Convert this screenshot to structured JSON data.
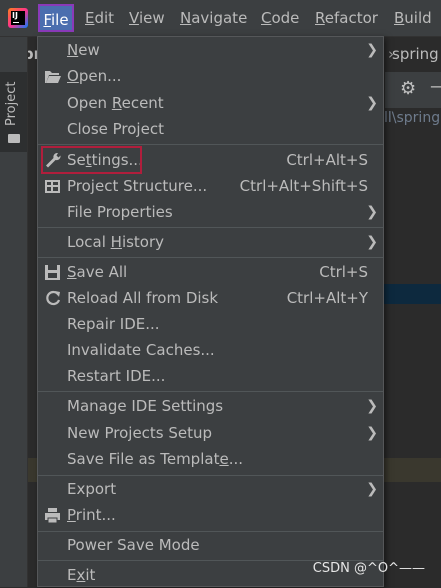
{
  "menubar": {
    "items": [
      {
        "pre": "",
        "u": "F",
        "post": "ile"
      },
      {
        "pre": "",
        "u": "E",
        "post": "dit"
      },
      {
        "pre": "",
        "u": "V",
        "post": "iew"
      },
      {
        "pre": "",
        "u": "N",
        "post": "avigate"
      },
      {
        "pre": "",
        "u": "C",
        "post": "ode"
      },
      {
        "pre": "",
        "u": "R",
        "post": "efactor"
      },
      {
        "pre": "",
        "u": "B",
        "post": "uild"
      }
    ]
  },
  "background": {
    "tab_text": "spr",
    "right_text": "spring",
    "path_text": "ll\\spring",
    "side_tab": "Project"
  },
  "file_menu": {
    "new": {
      "pre": "",
      "u": "N",
      "post": "ew"
    },
    "open": {
      "pre": "",
      "u": "O",
      "post": "pen..."
    },
    "open_recent": {
      "pre": "Open ",
      "u": "R",
      "post": "ecent"
    },
    "close_project": {
      "label": "Close Project"
    },
    "settings": {
      "pre": "Se",
      "u": "t",
      "post": "tings...",
      "shortcut": "Ctrl+Alt+S"
    },
    "project_structure": {
      "label": "Project Structure...",
      "shortcut": "Ctrl+Alt+Shift+S"
    },
    "file_properties": {
      "label": "File Properties"
    },
    "local_history": {
      "pre": "Local ",
      "u": "H",
      "post": "istory"
    },
    "save_all": {
      "pre": "",
      "u": "S",
      "post": "ave All",
      "shortcut": "Ctrl+S"
    },
    "reload": {
      "label": "Reload All from Disk",
      "shortcut": "Ctrl+Alt+Y"
    },
    "repair": {
      "label": "Repair IDE..."
    },
    "invalidate": {
      "label": "Invalidate Caches..."
    },
    "restart": {
      "label": "Restart IDE..."
    },
    "manage_settings": {
      "label": "Manage IDE Settings"
    },
    "new_projects_setup": {
      "label": "New Projects Setup"
    },
    "save_template": {
      "pre": "Save File as Templat",
      "u": "e",
      "post": "..."
    },
    "export": {
      "label": "Export"
    },
    "print": {
      "pre": "",
      "u": "P",
      "post": "rint..."
    },
    "power_save": {
      "label": "Power Save Mode"
    },
    "exit": {
      "pre": "E",
      "u": "x",
      "post": "it"
    }
  },
  "watermark": "CSDN @^O^——",
  "icons": {
    "app_logo": "intellij-logo-icon",
    "submenu": "chevron-right-icon",
    "open": "folder-open-icon",
    "settings": "wrench-icon",
    "save": "floppy-disk-icon",
    "reload": "refresh-icon",
    "print": "printer-icon"
  },
  "colors": {
    "menubar_bg": "#3c3f41",
    "file_selected": "#4b6eaf",
    "highlight_border": "#b01e3c",
    "text": "#bbbbbb"
  }
}
